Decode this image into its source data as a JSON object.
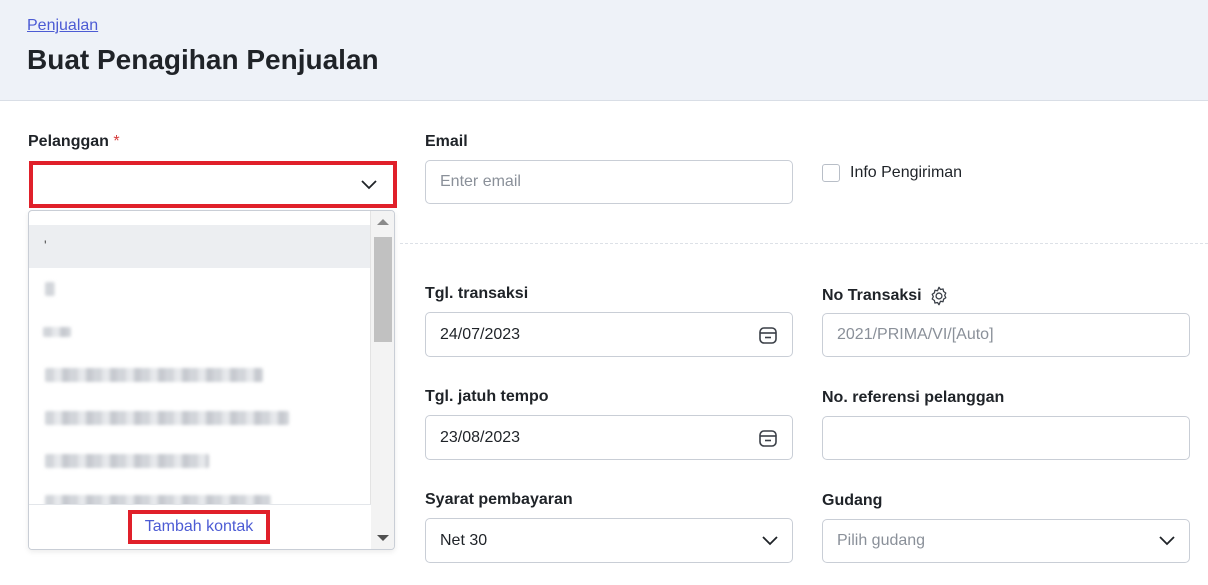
{
  "header": {
    "breadcrumb": "Penjualan",
    "title": "Buat Penagihan Penjualan"
  },
  "customer": {
    "label": "Pelanggan",
    "required_mark": "*",
    "value": "",
    "dropdown": {
      "first_item": "'",
      "add_contact_label": "Tambah kontak"
    }
  },
  "email": {
    "label": "Email",
    "placeholder": "Enter email"
  },
  "shipping_info": {
    "label": "Info Pengiriman",
    "checked": false
  },
  "transaction_date": {
    "label": "Tgl. transaksi",
    "value": "24/07/2023"
  },
  "transaction_no": {
    "label": "No Transaksi",
    "placeholder": "2021/PRIMA/VI/[Auto]"
  },
  "due_date": {
    "label": "Tgl. jatuh tempo",
    "value": "23/08/2023"
  },
  "customer_reference": {
    "label": "No. referensi pelanggan",
    "value": ""
  },
  "payment_terms": {
    "label": "Syarat pembayaran",
    "value": "Net 30"
  },
  "warehouse": {
    "label": "Gudang",
    "placeholder": "Pilih gudang"
  },
  "colors": {
    "accent": "#4c5bd4",
    "highlight": "#e0202a",
    "required": "#d63b3b"
  }
}
